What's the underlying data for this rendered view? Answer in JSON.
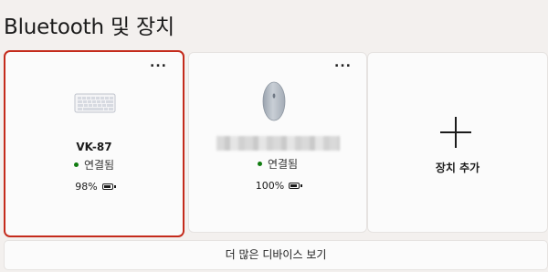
{
  "page": {
    "title": "Bluetooth 및 장치"
  },
  "devices": [
    {
      "name": "VK-87",
      "icon": "keyboard-icon",
      "status": "연결됨",
      "battery_label": "98%",
      "battery_level": 0.98,
      "more_label": "...",
      "selected": true
    },
    {
      "name": "",
      "icon": "mouse-icon",
      "status": "연결됨",
      "battery_label": "100%",
      "battery_level": 1.0,
      "more_label": "...",
      "selected": false
    }
  ],
  "add_device": {
    "label": "장치 추가",
    "icon": "plus-icon"
  },
  "more_devices": {
    "label": "더 많은 디바이스 보기"
  },
  "colors": {
    "accent_selected": "#c42b1c",
    "status_connected": "#107c10"
  }
}
